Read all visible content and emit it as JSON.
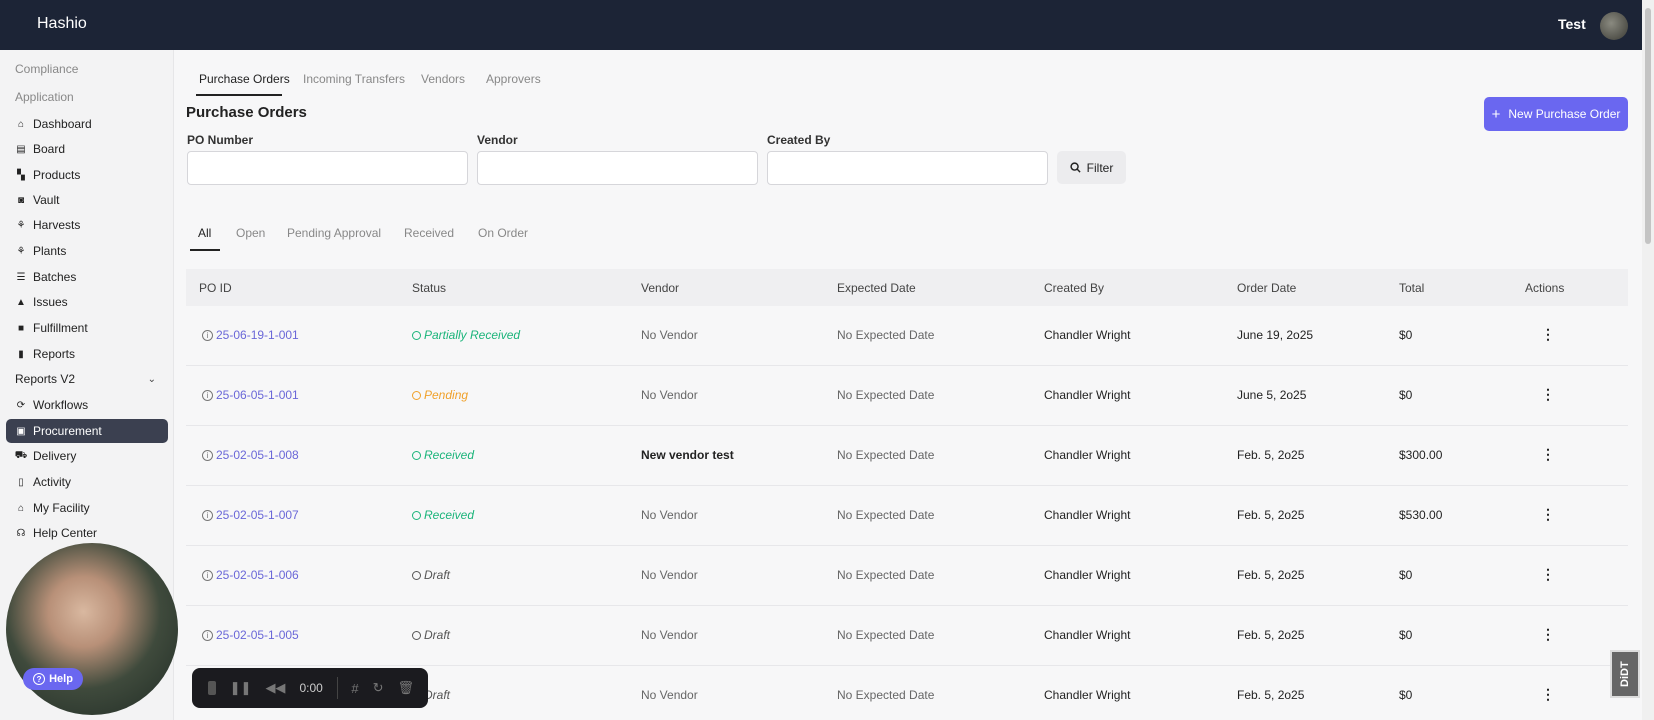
{
  "app": {
    "brand": "Hashio",
    "user_name": "Test"
  },
  "sidebar": {
    "sections": [
      "Compliance",
      "Application"
    ],
    "items": [
      {
        "label": "Dashboard",
        "icon": "home-icon"
      },
      {
        "label": "Board",
        "icon": "board-icon"
      },
      {
        "label": "Products",
        "icon": "products-icon"
      },
      {
        "label": "Vault",
        "icon": "vault-icon"
      },
      {
        "label": "Harvests",
        "icon": "harvest-icon"
      },
      {
        "label": "Plants",
        "icon": "plant-icon"
      },
      {
        "label": "Batches",
        "icon": "batches-icon"
      },
      {
        "label": "Issues",
        "icon": "warning-icon"
      },
      {
        "label": "Fulfillment",
        "icon": "box-icon"
      },
      {
        "label": "Reports",
        "icon": "bar-chart-icon"
      },
      {
        "label": "Reports V2",
        "icon": "chevron-down-icon"
      },
      {
        "label": "Workflows",
        "icon": "workflow-icon"
      },
      {
        "label": "Procurement",
        "icon": "bag-icon",
        "active": true
      },
      {
        "label": "Delivery",
        "icon": "truck-icon"
      },
      {
        "label": "Activity",
        "icon": "clipboard-icon"
      },
      {
        "label": "My Facility",
        "icon": "warehouse-icon"
      },
      {
        "label": "Help Center",
        "icon": "headset-icon"
      }
    ]
  },
  "tabs": [
    "Purchase Orders",
    "Incoming Transfers",
    "Vendors",
    "Approvers"
  ],
  "page_title": "Purchase Orders",
  "new_button_label": "New Purchase Order",
  "filters": {
    "po_number_label": "PO Number",
    "vendor_label": "Vendor",
    "created_by_label": "Created By",
    "po_number_value": "",
    "vendor_value": "",
    "created_by_value": "",
    "filter_button": "Filter"
  },
  "status_tabs": [
    "All",
    "Open",
    "Pending Approval",
    "Received",
    "On Order"
  ],
  "table": {
    "headers": [
      "PO ID",
      "Status",
      "Vendor",
      "Expected Date",
      "Created By",
      "Order Date",
      "Total",
      "Actions"
    ],
    "rows": [
      {
        "po_id": "25-06-19-1-001",
        "status": "Partially Received",
        "vendor": "No Vendor",
        "expected": "No Expected Date",
        "created_by": "Chandler Wright",
        "order_date": "June 19, 2o25",
        "total": "$0"
      },
      {
        "po_id": "25-06-05-1-001",
        "status": "Pending",
        "vendor": "No Vendor",
        "expected": "No Expected Date",
        "created_by": "Chandler Wright",
        "order_date": "June 5, 2o25",
        "total": "$0"
      },
      {
        "po_id": "25-02-05-1-008",
        "status": "Received",
        "vendor": "New vendor test",
        "expected": "No Expected Date",
        "created_by": "Chandler Wright",
        "order_date": "Feb. 5, 2o25",
        "total": "$300.00"
      },
      {
        "po_id": "25-02-05-1-007",
        "status": "Received",
        "vendor": "No Vendor",
        "expected": "No Expected Date",
        "created_by": "Chandler Wright",
        "order_date": "Feb. 5, 2o25",
        "total": "$530.00"
      },
      {
        "po_id": "25-02-05-1-006",
        "status": "Draft",
        "vendor": "No Vendor",
        "expected": "No Expected Date",
        "created_by": "Chandler Wright",
        "order_date": "Feb. 5, 2o25",
        "total": "$0"
      },
      {
        "po_id": "25-02-05-1-005",
        "status": "Draft",
        "vendor": "No Vendor",
        "expected": "No Expected Date",
        "created_by": "Chandler Wright",
        "order_date": "Feb. 5, 2o25",
        "total": "$0"
      },
      {
        "po_id": "",
        "status": "Draft",
        "vendor": "No Vendor",
        "expected": "No Expected Date",
        "created_by": "Chandler Wright",
        "order_date": "Feb. 5, 2o25",
        "total": "$0"
      }
    ]
  },
  "status_colors": {
    "Partially Received": "#1bb47a",
    "Pending": "#f0a12a",
    "Received": "#1bb47a",
    "Draft": "#555555"
  },
  "overlays": {
    "help_label": "Help",
    "recorder_time": "0:00",
    "watermark": "DiDT"
  },
  "colors": {
    "accent": "#6a67f0",
    "topbar": "#1c2436",
    "link": "#6a67d8"
  }
}
